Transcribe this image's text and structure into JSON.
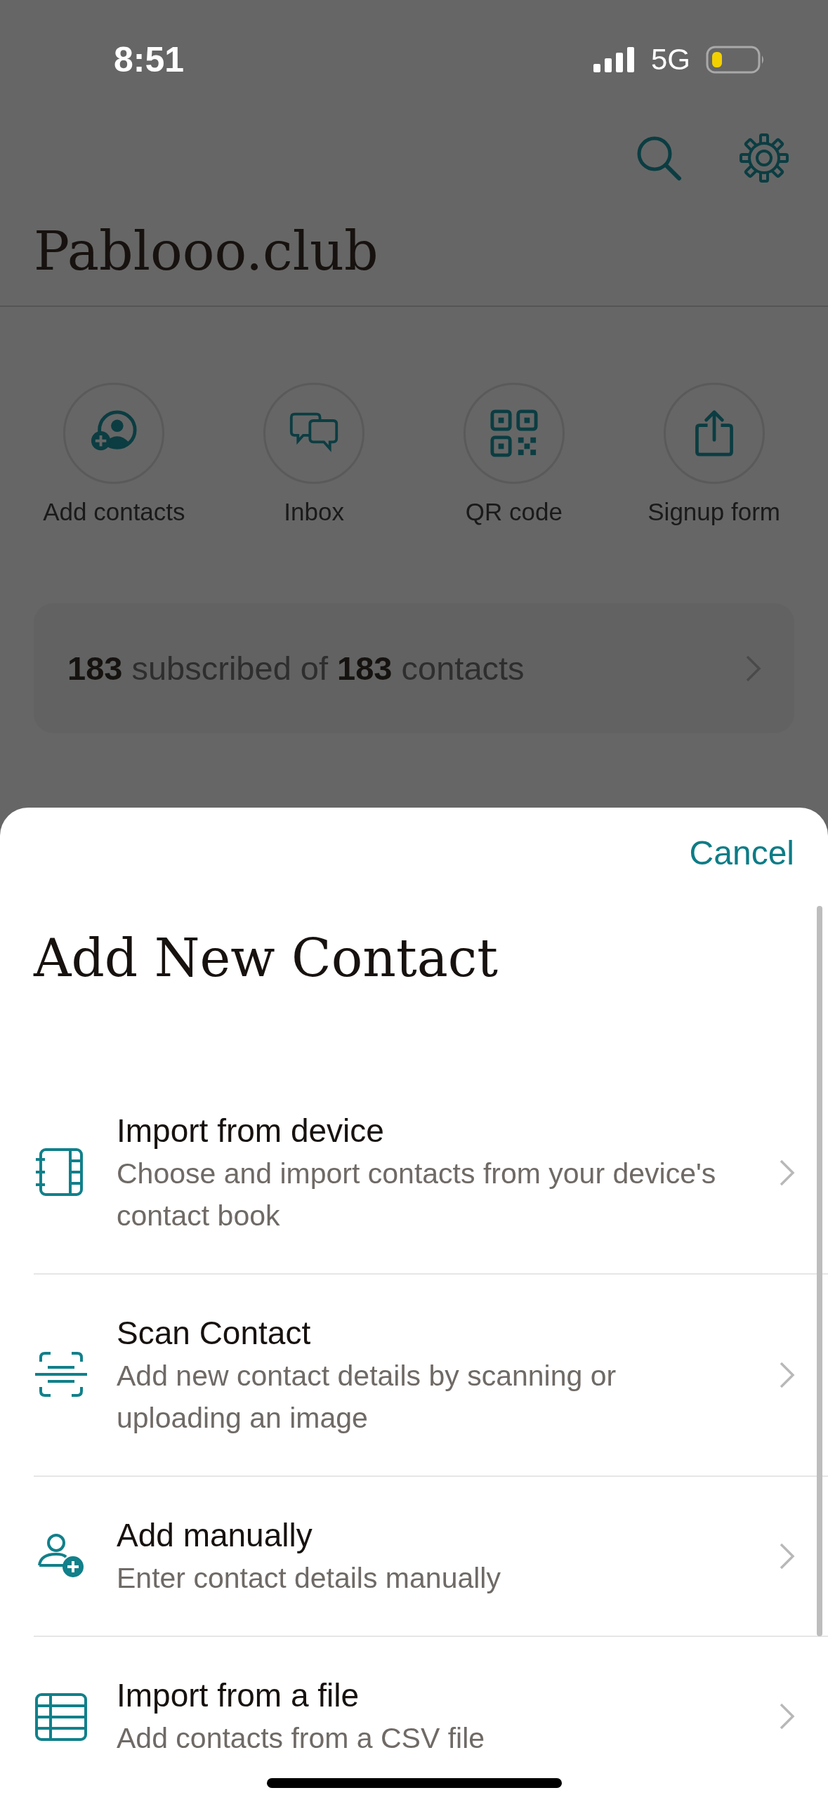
{
  "status_bar": {
    "time": "8:51",
    "network": "5G"
  },
  "header": {
    "title": "Pablooo.club"
  },
  "quick_actions": [
    {
      "kind": "add-contact",
      "label": "Add contacts"
    },
    {
      "kind": "inbox",
      "label": "Inbox"
    },
    {
      "kind": "qr",
      "label": "QR code"
    },
    {
      "kind": "share",
      "label": "Signup form"
    }
  ],
  "summary": {
    "text": "**183** subscribed of **183** contacts"
  },
  "sheet": {
    "cancel": "Cancel",
    "title": "Add New Contact",
    "options": [
      {
        "kind": "device",
        "title": "Import from device",
        "description": "Choose and import contacts from your device's contact book"
      },
      {
        "kind": "scan",
        "title": "Scan Contact",
        "description": "Add new contact details by scanning or uploading an image"
      },
      {
        "kind": "manual",
        "title": "Add manually",
        "description": "Enter contact details manually"
      },
      {
        "kind": "file",
        "title": "Import from a file",
        "description": "Add contacts from a CSV file"
      }
    ]
  }
}
